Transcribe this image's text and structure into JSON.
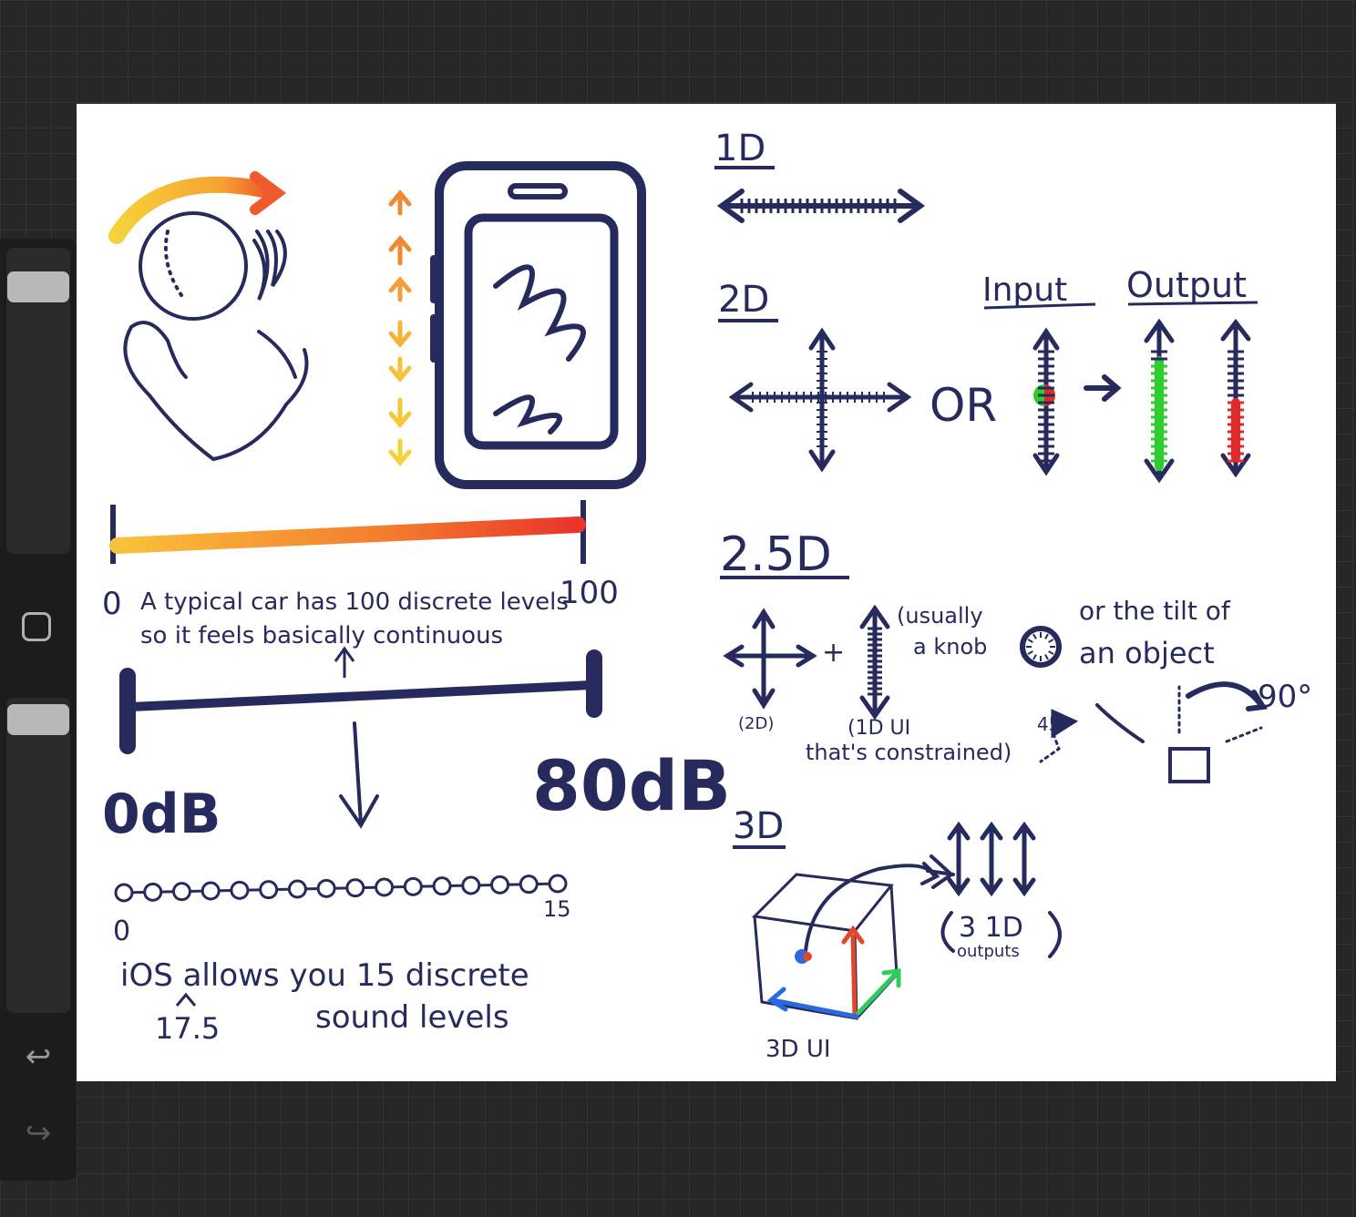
{
  "toolbar": {
    "undo_icon": "undo-icon",
    "redo_icon": "redo-icon",
    "brush_size": 0.1,
    "opacity": 0.1
  },
  "sketch": {
    "car": {
      "left_label": "0",
      "right_label": "100",
      "caption_line1": "A typical car has 100 discrete levels",
      "caption_line2": "so it feels basically continuous"
    },
    "volume": {
      "min_label": "0dB",
      "max_label": "80dB"
    },
    "ios": {
      "start_label": "0",
      "end_label": "15",
      "caption_line1": "iOS allows you 15 discrete",
      "caption_line2": "sound levels",
      "note": "17.5"
    },
    "one_d": {
      "heading": "1D"
    },
    "two_d": {
      "heading": "2D",
      "or_label": "OR",
      "input_label": "Input",
      "output_label": "Output"
    },
    "two_five_d": {
      "heading": "2.5D",
      "plus": "+",
      "note_usually": "(usually",
      "note_knob": "a knob",
      "or_tilt": "or the tilt of",
      "an_object": "an object",
      "label_2d": "(2D)",
      "label_1d_ui": "(1D UI",
      "label_constrained": "that's constrained)",
      "angle_45": "45°",
      "angle_90": "90°"
    },
    "three_d": {
      "heading": "3D",
      "ui_label": "3D UI",
      "outputs_line1": "3 1D",
      "outputs_line2": "outputs"
    }
  },
  "colors": {
    "ink": "#262a5c",
    "green": "#2ecc2e",
    "red": "#e02a2a",
    "orange": "#f08a30",
    "yellow": "#f5d23a"
  }
}
